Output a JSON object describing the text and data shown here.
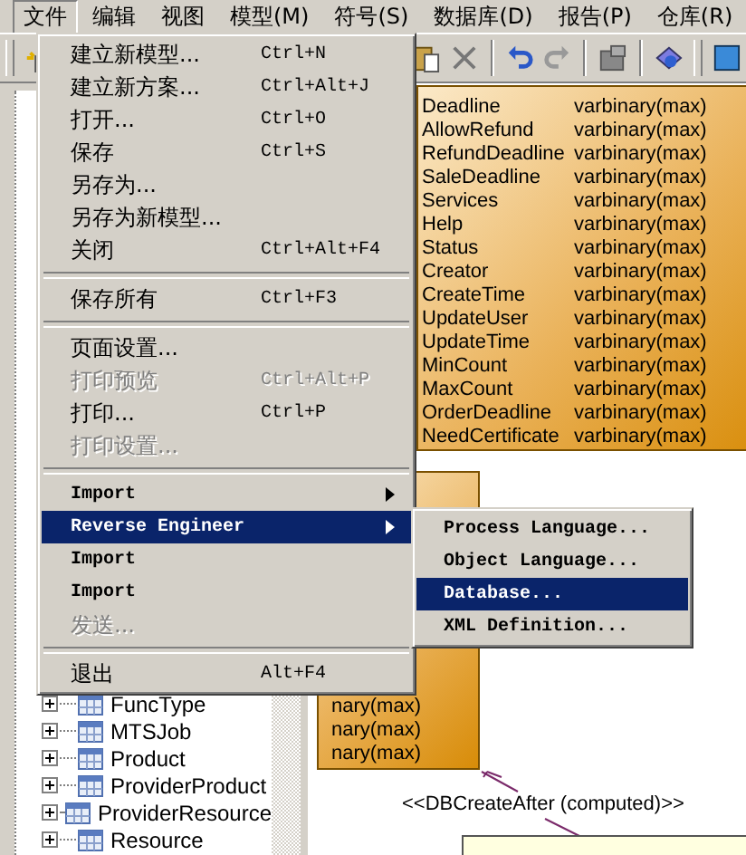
{
  "menubar": [
    {
      "label": "文件",
      "selected": true
    },
    {
      "label": "编辑",
      "selected": false
    },
    {
      "label": "视图",
      "selected": false
    },
    {
      "label": "模型(M)",
      "selected": false
    },
    {
      "label": "符号(S)",
      "selected": false
    },
    {
      "label": "数据库(D)",
      "selected": false
    },
    {
      "label": "报告(P)",
      "selected": false
    },
    {
      "label": "仓库(R)",
      "selected": false
    }
  ],
  "file_menu": {
    "items": [
      {
        "kind": "item",
        "label": "建立新模型...",
        "shortcut": "Ctrl+N",
        "disabled": false,
        "selected": false,
        "submenu": false
      },
      {
        "kind": "item",
        "label": "建立新方案...",
        "shortcut": "Ctrl+Alt+J",
        "disabled": false,
        "selected": false,
        "submenu": false
      },
      {
        "kind": "item",
        "label": "打开...",
        "shortcut": "Ctrl+O",
        "disabled": false,
        "selected": false,
        "submenu": false
      },
      {
        "kind": "item",
        "label": "保存",
        "shortcut": "Ctrl+S",
        "disabled": false,
        "selected": false,
        "submenu": false
      },
      {
        "kind": "item",
        "label": "另存为...",
        "disabled": false,
        "selected": false,
        "submenu": false
      },
      {
        "kind": "item",
        "label": "另存为新模型...",
        "disabled": false,
        "selected": false,
        "submenu": false
      },
      {
        "kind": "item",
        "label": "关闭",
        "shortcut": "Ctrl+Alt+F4",
        "disabled": false,
        "selected": false,
        "submenu": false
      },
      {
        "kind": "separator"
      },
      {
        "kind": "item",
        "label": "保存所有",
        "shortcut": "Ctrl+F3",
        "disabled": false,
        "selected": false,
        "submenu": false
      },
      {
        "kind": "separator"
      },
      {
        "kind": "item",
        "label": "页面设置...",
        "disabled": false,
        "selected": false,
        "submenu": false
      },
      {
        "kind": "item",
        "label": "打印预览",
        "shortcut": "Ctrl+Alt+P",
        "disabled": true,
        "selected": false,
        "submenu": false
      },
      {
        "kind": "item",
        "label": "打印...",
        "shortcut": "Ctrl+P",
        "disabled": false,
        "selected": false,
        "submenu": false
      },
      {
        "kind": "item",
        "label": "打印设置...",
        "disabled": true,
        "selected": false,
        "submenu": false
      },
      {
        "kind": "separator"
      },
      {
        "kind": "item",
        "label": "Import",
        "disabled": false,
        "selected": false,
        "submenu": true
      },
      {
        "kind": "item",
        "label": "Reverse Engineer",
        "disabled": false,
        "selected": true,
        "submenu": true
      },
      {
        "kind": "item",
        "label": "Import",
        "disabled": false,
        "selected": false,
        "submenu": false
      },
      {
        "kind": "item",
        "label": "Import",
        "disabled": false,
        "selected": false,
        "submenu": false
      },
      {
        "kind": "item",
        "label": "发送...",
        "disabled": true,
        "selected": false,
        "submenu": false
      },
      {
        "kind": "separator"
      },
      {
        "kind": "item",
        "label": "退出",
        "shortcut": "Alt+F4",
        "disabled": false,
        "selected": false,
        "submenu": false
      }
    ]
  },
  "submenu": {
    "items": [
      {
        "kind": "item",
        "label": "Process Language...",
        "disabled": false,
        "selected": false,
        "submenu": false
      },
      {
        "kind": "item",
        "label": "Object Language...",
        "disabled": false,
        "selected": false,
        "submenu": false
      },
      {
        "kind": "item",
        "label": "Database...",
        "disabled": false,
        "selected": true,
        "submenu": false
      },
      {
        "kind": "item",
        "label": "XML Definition...",
        "disabled": false,
        "selected": false,
        "submenu": false
      }
    ]
  },
  "tree": {
    "items": [
      {
        "label": "FuncType",
        "expanded": false
      },
      {
        "label": "MTSJob",
        "expanded": false
      },
      {
        "label": "Product",
        "expanded": false
      },
      {
        "label": "ProviderProduct",
        "expanded": false
      },
      {
        "label": "ProviderResource",
        "expanded": false
      },
      {
        "label": "Resource",
        "expanded": false
      }
    ]
  },
  "entities": [
    {
      "rows": [
        {
          "name": "Deadline",
          "type": "varbinary(max)"
        },
        {
          "name": "AllowRefund",
          "type": "varbinary(max)"
        },
        {
          "name": "RefundDeadline",
          "type": "varbinary(max)"
        },
        {
          "name": "SaleDeadline",
          "type": "varbinary(max)"
        },
        {
          "name": "Services",
          "type": "varbinary(max)"
        },
        {
          "name": "Help",
          "type": "varbinary(max)"
        },
        {
          "name": "Status",
          "type": "varbinary(max)"
        },
        {
          "name": "Creator",
          "type": "varbinary(max)"
        },
        {
          "name": "CreateTime",
          "type": "varbinary(max)"
        },
        {
          "name": "UpdateUser",
          "type": "varbinary(max)"
        },
        {
          "name": "UpdateTime",
          "type": "varbinary(max)"
        },
        {
          "name": "MinCount",
          "type": "varbinary(max)"
        },
        {
          "name": "MaxCount",
          "type": "varbinary(max)"
        },
        {
          "name": "OrderDeadline",
          "type": "varbinary(max)"
        },
        {
          "name": "NeedCertificate",
          "type": "varbinary(max)"
        }
      ]
    },
    {
      "rows": [
        {
          "type": "nary(max)"
        },
        {
          "type": "nary(max)"
        },
        {
          "type": "nary(max)"
        }
      ]
    }
  ],
  "link_label": "<<DBCreateAfter (computed)>>"
}
